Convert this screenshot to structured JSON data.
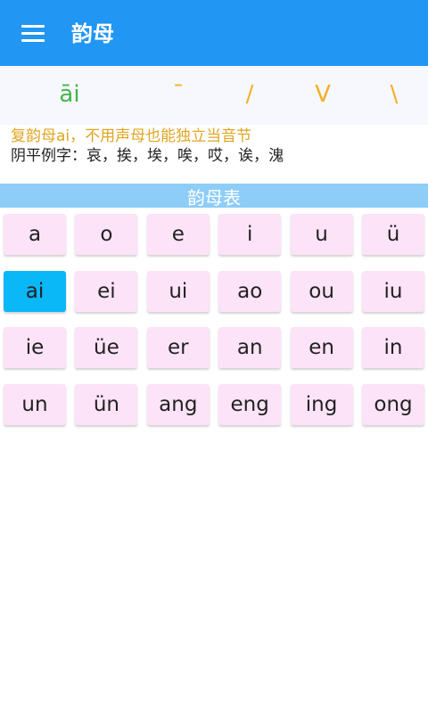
{
  "app_bar": {
    "title": "韵母",
    "menu_icon": "hamburger-menu-icon",
    "background": "#2196f3"
  },
  "tones": [
    {
      "label": "āi",
      "active": true
    },
    {
      "label": "ˉ",
      "active": false
    },
    {
      "label": "/",
      "active": false
    },
    {
      "label": "V",
      "active": false
    },
    {
      "label": "\\",
      "active": false
    }
  ],
  "info": {
    "title": "复韵母ai，不用声母也能独立当音节",
    "examples": "阴平例字：哀，挨，埃，唉，哎，诶，溾"
  },
  "section": {
    "title": "韵母表"
  },
  "finals": [
    [
      "a",
      "o",
      "e",
      "i",
      "u",
      "ü"
    ],
    [
      "ai",
      "ei",
      "ui",
      "ao",
      "ou",
      "iu"
    ],
    [
      "ie",
      "üe",
      "er",
      "an",
      "en",
      "in"
    ],
    [
      "un",
      "ün",
      "ang",
      "eng",
      "ing",
      "ong"
    ]
  ],
  "selected_final": "ai",
  "colors": {
    "tone_active": "#42b54a",
    "tone_default": "#f2b027",
    "cell_bg": "#fce3f7",
    "cell_selected": "#0ab7f7",
    "section_bg": "#8ecdf8"
  }
}
